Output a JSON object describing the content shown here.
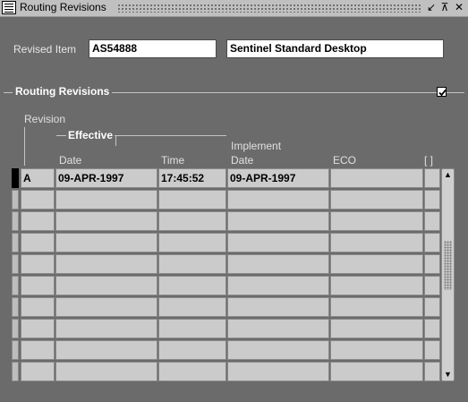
{
  "window": {
    "title": "Routing Revisions",
    "controls": [
      "↙",
      "⊼",
      "✕"
    ]
  },
  "item": {
    "label": "Revised Item",
    "code": "AS54888",
    "description": "Sentinel Standard Desktop"
  },
  "section": {
    "title": "Routing Revisions",
    "checked": true
  },
  "columns": {
    "revision": "Revision",
    "effective": "Effective",
    "date": "Date",
    "time": "Time",
    "implement": "Implement",
    "implement_date": "Date",
    "eco": "ECO",
    "more": "[ ]"
  },
  "rows": [
    {
      "revision": "A",
      "eff_date": "09-APR-1997",
      "eff_time": "17:45:52",
      "impl_date": "09-APR-1997",
      "eco": "",
      "more": ""
    },
    {
      "revision": "",
      "eff_date": "",
      "eff_time": "",
      "impl_date": "",
      "eco": "",
      "more": ""
    },
    {
      "revision": "",
      "eff_date": "",
      "eff_time": "",
      "impl_date": "",
      "eco": "",
      "more": ""
    },
    {
      "revision": "",
      "eff_date": "",
      "eff_time": "",
      "impl_date": "",
      "eco": "",
      "more": ""
    },
    {
      "revision": "",
      "eff_date": "",
      "eff_time": "",
      "impl_date": "",
      "eco": "",
      "more": ""
    },
    {
      "revision": "",
      "eff_date": "",
      "eff_time": "",
      "impl_date": "",
      "eco": "",
      "more": ""
    },
    {
      "revision": "",
      "eff_date": "",
      "eff_time": "",
      "impl_date": "",
      "eco": "",
      "more": ""
    },
    {
      "revision": "",
      "eff_date": "",
      "eff_time": "",
      "impl_date": "",
      "eco": "",
      "more": ""
    },
    {
      "revision": "",
      "eff_date": "",
      "eff_time": "",
      "impl_date": "",
      "eco": "",
      "more": ""
    },
    {
      "revision": "",
      "eff_date": "",
      "eff_time": "",
      "impl_date": "",
      "eco": "",
      "more": ""
    }
  ],
  "scrollbar": {
    "up": "▲",
    "down": "▼"
  }
}
